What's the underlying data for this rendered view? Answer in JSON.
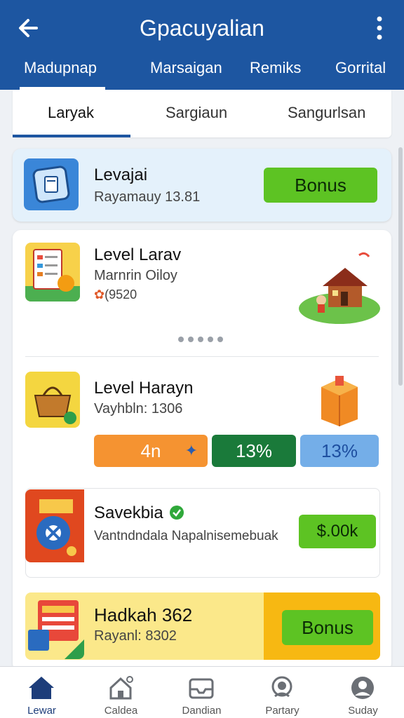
{
  "appbar": {
    "title": "Gpacuyalian"
  },
  "top_tabs": [
    "Madupnap",
    "Marsaigan",
    "Remiks",
    "Gorrital"
  ],
  "sub_tabs": [
    "Laryak",
    "Sargiaun",
    "Sangurlsan"
  ],
  "card1": {
    "title": "Levajai",
    "subtitle": "Rayamauy 13.81",
    "button": "Bonus"
  },
  "row1": {
    "title": "Level Larav",
    "subtitle": "Marnrin Oiloy",
    "meta": "(9520"
  },
  "row2": {
    "title": "Level Harayn",
    "subtitle": "Vayhbln: 1306",
    "pills": [
      "4n",
      "13%",
      "13%"
    ]
  },
  "row3": {
    "title": "Savekbia",
    "subtitle": "Vantndndala Napalnisemebuak",
    "button": "$.00k"
  },
  "row4": {
    "title": "Hadkah 362",
    "subtitle": "Rayanl: 8302",
    "button": "Bonus"
  },
  "bottom_nav": [
    "Lewar",
    "Caldea",
    "Dandian",
    "Partary",
    "Suday"
  ],
  "colors": {
    "primary": "#1d56a1",
    "green_button": "#5dc323",
    "orange_pill": "#f59331",
    "dark_green_pill": "#1a7a3a",
    "blue_pill": "#74aee8"
  }
}
